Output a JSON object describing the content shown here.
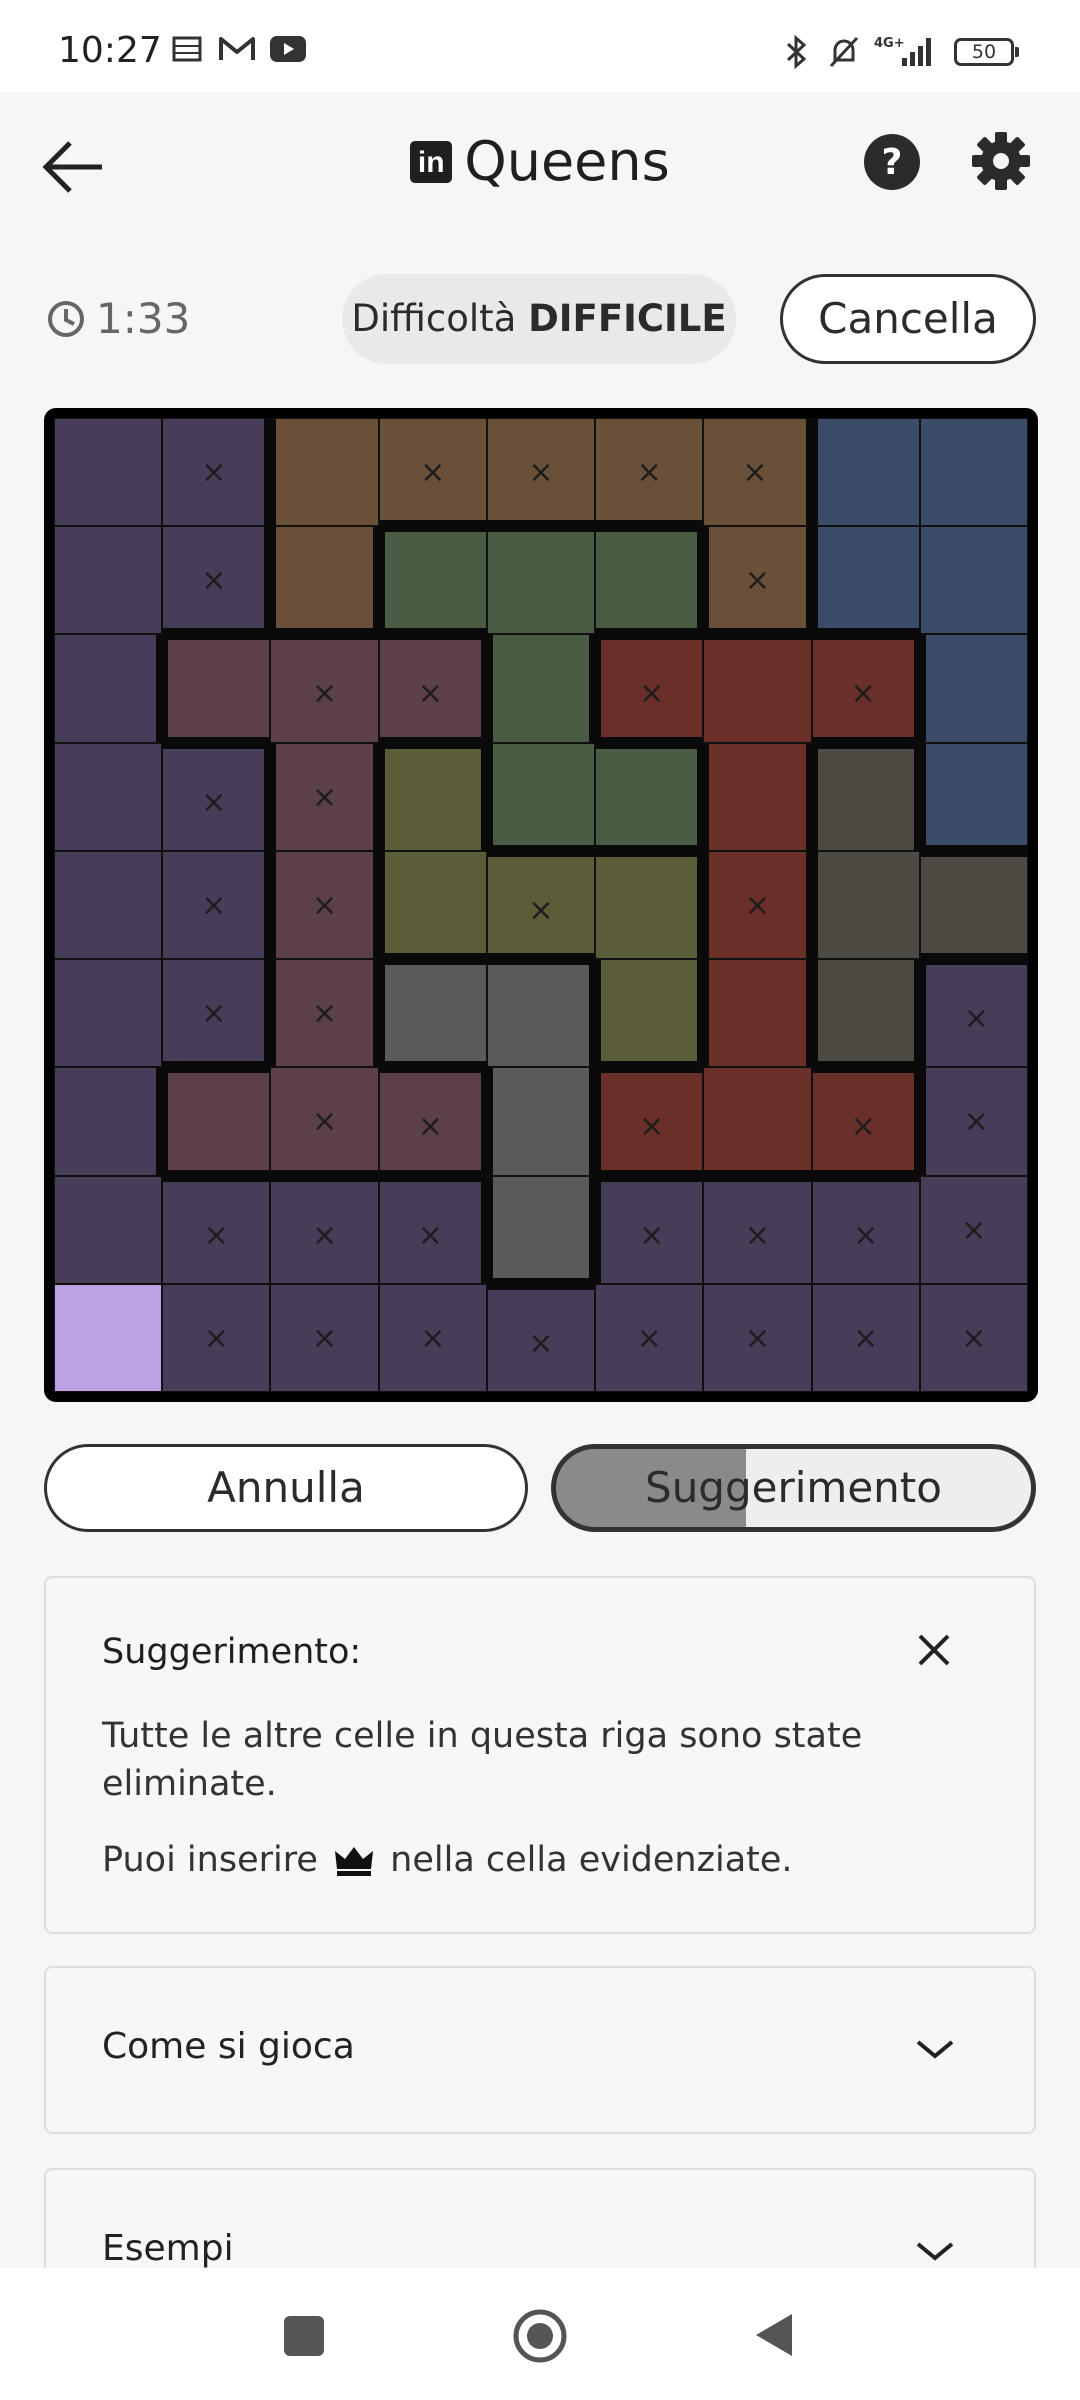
{
  "status": {
    "time": "10:27",
    "network": "4G+",
    "battery": "50"
  },
  "header": {
    "title": "Queens",
    "logo_text": "in"
  },
  "game": {
    "timer": "1:33",
    "difficulty_prefix": "Difficoltà",
    "difficulty_value": "DIFFICILE",
    "clear_label": "Cancella",
    "undo_label": "Annulla",
    "hint_label": "Suggerimento",
    "hint_progress": 0.4
  },
  "board": {
    "size": 9,
    "mark_symbol": "×",
    "region_colors": {
      "purple": "#473d59",
      "brown": "#6a5039",
      "blue": "#3c4b68",
      "green": "#4a5d44",
      "plum": "#5b3f4a",
      "red": "#6a2f28",
      "olive": "#5b5d38",
      "charcoal": "#4c4a42",
      "gray": "#5a5a5a",
      "highlight": "#bca2e2"
    },
    "rows": [
      [
        {
          "c": "purple",
          "x": false
        },
        {
          "c": "purple",
          "x": true
        },
        {
          "c": "brown",
          "x": false
        },
        {
          "c": "brown",
          "x": true
        },
        {
          "c": "brown",
          "x": true
        },
        {
          "c": "brown",
          "x": true
        },
        {
          "c": "brown",
          "x": true
        },
        {
          "c": "blue",
          "x": false
        },
        {
          "c": "blue",
          "x": false
        }
      ],
      [
        {
          "c": "purple",
          "x": false
        },
        {
          "c": "purple",
          "x": true
        },
        {
          "c": "brown",
          "x": false
        },
        {
          "c": "green",
          "x": false
        },
        {
          "c": "green",
          "x": false
        },
        {
          "c": "green",
          "x": false
        },
        {
          "c": "brown",
          "x": true
        },
        {
          "c": "blue",
          "x": false
        },
        {
          "c": "blue",
          "x": false
        }
      ],
      [
        {
          "c": "purple",
          "x": false
        },
        {
          "c": "plum",
          "x": false
        },
        {
          "c": "plum",
          "x": true
        },
        {
          "c": "plum",
          "x": true
        },
        {
          "c": "green",
          "x": false
        },
        {
          "c": "red",
          "x": true
        },
        {
          "c": "red",
          "x": false
        },
        {
          "c": "red",
          "x": true
        },
        {
          "c": "blue",
          "x": false
        }
      ],
      [
        {
          "c": "purple",
          "x": false
        },
        {
          "c": "purple",
          "x": true
        },
        {
          "c": "plum",
          "x": true
        },
        {
          "c": "olive",
          "x": false
        },
        {
          "c": "green",
          "x": false
        },
        {
          "c": "green",
          "x": false
        },
        {
          "c": "red",
          "x": false
        },
        {
          "c": "charcoal",
          "x": false
        },
        {
          "c": "blue",
          "x": false
        }
      ],
      [
        {
          "c": "purple",
          "x": false
        },
        {
          "c": "purple",
          "x": true
        },
        {
          "c": "plum",
          "x": true
        },
        {
          "c": "olive",
          "x": false
        },
        {
          "c": "olive",
          "x": true
        },
        {
          "c": "olive",
          "x": false
        },
        {
          "c": "red",
          "x": true
        },
        {
          "c": "charcoal",
          "x": false
        },
        {
          "c": "charcoal",
          "x": false
        }
      ],
      [
        {
          "c": "purple",
          "x": false
        },
        {
          "c": "purple",
          "x": true
        },
        {
          "c": "plum",
          "x": true
        },
        {
          "c": "gray",
          "x": false
        },
        {
          "c": "gray",
          "x": false
        },
        {
          "c": "olive",
          "x": false
        },
        {
          "c": "red",
          "x": false
        },
        {
          "c": "charcoal",
          "x": false
        },
        {
          "c": "purple",
          "x": true
        }
      ],
      [
        {
          "c": "purple",
          "x": false
        },
        {
          "c": "plum",
          "x": false
        },
        {
          "c": "plum",
          "x": true
        },
        {
          "c": "plum",
          "x": true
        },
        {
          "c": "gray",
          "x": false
        },
        {
          "c": "red",
          "x": true
        },
        {
          "c": "red",
          "x": false
        },
        {
          "c": "red",
          "x": true
        },
        {
          "c": "purple",
          "x": true
        }
      ],
      [
        {
          "c": "purple",
          "x": false
        },
        {
          "c": "purple",
          "x": true
        },
        {
          "c": "purple",
          "x": true
        },
        {
          "c": "purple",
          "x": true
        },
        {
          "c": "gray",
          "x": false
        },
        {
          "c": "purple",
          "x": true
        },
        {
          "c": "purple",
          "x": true
        },
        {
          "c": "purple",
          "x": true
        },
        {
          "c": "purple",
          "x": true
        }
      ],
      [
        {
          "c": "highlight",
          "x": false
        },
        {
          "c": "purple",
          "x": true
        },
        {
          "c": "purple",
          "x": true
        },
        {
          "c": "purple",
          "x": true
        },
        {
          "c": "purple",
          "x": true
        },
        {
          "c": "purple",
          "x": true
        },
        {
          "c": "purple",
          "x": true
        },
        {
          "c": "purple",
          "x": true
        },
        {
          "c": "purple",
          "x": true
        }
      ]
    ]
  },
  "hint_card": {
    "title": "Suggerimento:",
    "text": "Tutte le altre celle in questa riga sono state eliminate.",
    "text2_before": "Puoi inserire",
    "text2_after": "nella cella evidenziate."
  },
  "sections": {
    "how_to_play": "Come si gioca",
    "examples": "Esempi"
  },
  "icons": {
    "back": "arrow-left-icon",
    "help": "question-circle-icon",
    "settings": "gear-icon",
    "timer": "clock-icon",
    "close": "close-icon",
    "expand": "chevron-down-icon",
    "queen": "crown-icon"
  }
}
